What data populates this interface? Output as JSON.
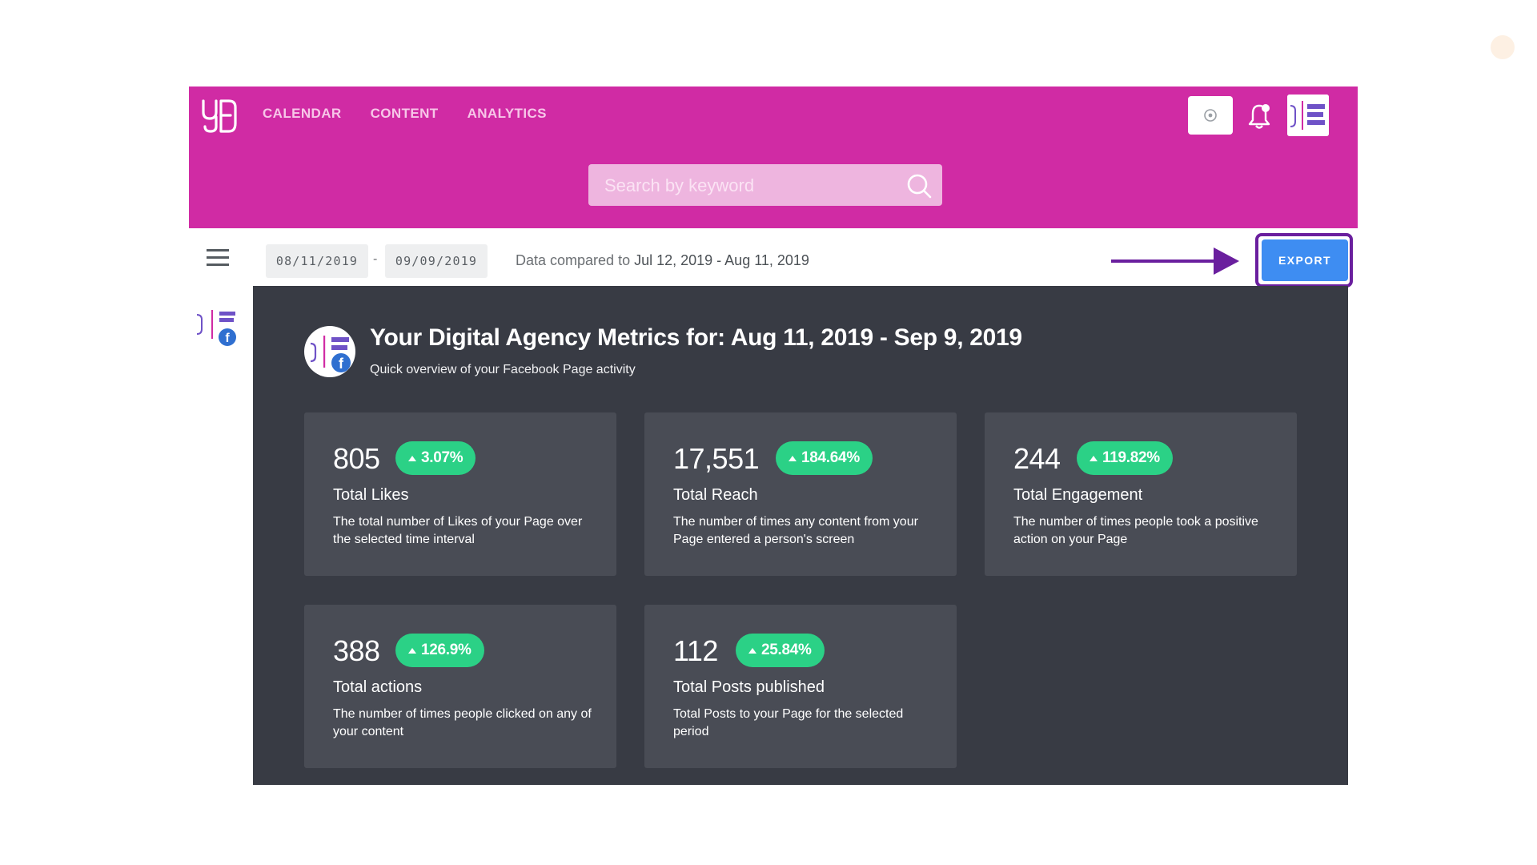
{
  "header": {
    "nav": [
      "CALENDAR",
      "CONTENT",
      "ANALYTICS"
    ],
    "search_placeholder": "Search by keyword",
    "logo_icon": "yd-logo-icon",
    "accent_color": "#d02ba4"
  },
  "toolbar": {
    "date_from": "08/11/2019",
    "date_separator": "-",
    "date_to": "09/09/2019",
    "compare_prefix": "Data compared to",
    "compare_range": "Jul 12, 2019 - Aug 11, 2019",
    "export_label": "EXPORT",
    "export_color": "#3e8df2",
    "annotation_color": "#6a1f9e"
  },
  "main": {
    "title": "Your Digital Agency Metrics for: Aug 11, 2019 - Sep 9, 2019",
    "subtitle": "Quick overview of your Facebook Page activity",
    "badge_color": "#2bd186",
    "cards": [
      {
        "value": "805",
        "change": "3.07%",
        "label": "Total Likes",
        "desc": "The total number of Likes of your Page over the selected time interval"
      },
      {
        "value": "17,551",
        "change": "184.64%",
        "label": "Total Reach",
        "desc": "The number of times any content from your Page entered a person's screen"
      },
      {
        "value": "244",
        "change": "119.82%",
        "label": "Total Engagement",
        "desc": "The number of times people took a positive action on your Page"
      },
      {
        "value": "388",
        "change": "126.9%",
        "label": "Total actions",
        "desc": "The number of times people clicked on any of your content"
      },
      {
        "value": "112",
        "change": "25.84%",
        "label": "Total Posts published",
        "desc": "Total Posts to your Page for the selected period"
      }
    ]
  }
}
